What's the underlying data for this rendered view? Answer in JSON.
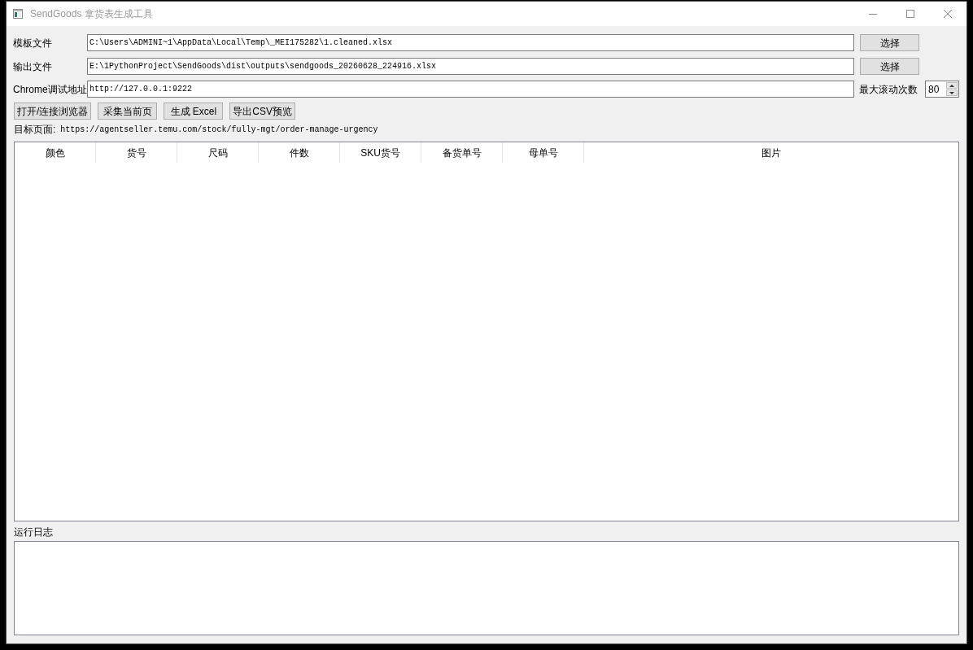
{
  "window": {
    "title": "SendGoods 拿货表生成工具"
  },
  "form": {
    "rows": [
      {
        "kind": "file",
        "label": "模板文件",
        "value": "C:\\Users\\ADMINI~1\\AppData\\Local\\Temp\\_MEI175282\\1.cleaned.xlsx",
        "button": "选择"
      },
      {
        "kind": "file",
        "label": "输出文件",
        "value": "E:\\1PythonProject\\SendGoods\\dist\\outputs\\sendgoods_20260628_224916.xlsx",
        "button": "选择"
      },
      {
        "kind": "address",
        "label": "Chrome调试地址",
        "value": "http://127.0.0.1:9222",
        "spin_label": "最大滚动次数",
        "spin_value": "80"
      }
    ]
  },
  "actions": [
    "打开/连接浏览器",
    "采集当前页",
    "生成 Excel",
    "导出CSV预览"
  ],
  "target_page": {
    "label": "目标页面:",
    "url": "https://agentseller.temu.com/stock/fully-mgt/order-manage-urgency"
  },
  "table": {
    "columns": [
      "颜色",
      "货号",
      "尺码",
      "件数",
      "SKU货号",
      "备货单号",
      "母单号",
      "图片"
    ]
  },
  "log": {
    "label": "运行日志"
  }
}
